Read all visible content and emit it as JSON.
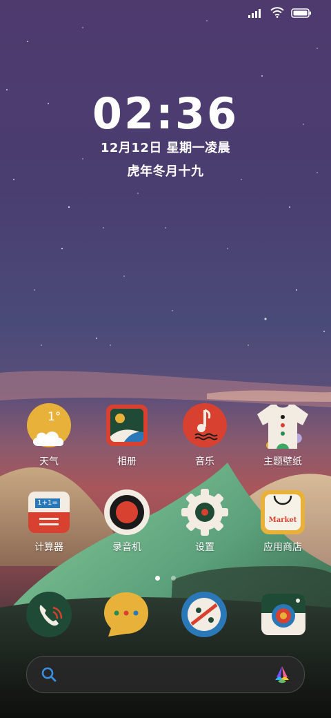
{
  "status": {
    "signal_icon": "signal-bars-icon",
    "wifi_icon": "wifi-icon",
    "battery_icon": "battery-full-icon"
  },
  "clock": {
    "time": "02:36",
    "date": "12月12日 星期一凌晨",
    "lunar": "虎年冬月十九"
  },
  "weather": {
    "temperature": "1°"
  },
  "apps": [
    {
      "label": "天气",
      "icon": "weather-icon"
    },
    {
      "label": "相册",
      "icon": "gallery-icon"
    },
    {
      "label": "音乐",
      "icon": "music-icon"
    },
    {
      "label": "主题壁纸",
      "icon": "themes-icon"
    },
    {
      "label": "计算器",
      "icon": "calculator-icon"
    },
    {
      "label": "录音机",
      "icon": "recorder-icon"
    },
    {
      "label": "设置",
      "icon": "settings-icon"
    },
    {
      "label": "应用商店",
      "icon": "app-store-icon"
    }
  ],
  "calculator_screen": "1+1=",
  "market_text": "Market",
  "page_indicator": {
    "pages": 2,
    "current": 1
  },
  "dock": [
    {
      "icon": "phone-icon"
    },
    {
      "icon": "messages-icon"
    },
    {
      "icon": "browser-icon"
    },
    {
      "icon": "camera-icon"
    }
  ],
  "search": {
    "search_icon": "search-icon",
    "assistant_icon": "assistant-icon"
  },
  "colors": {
    "accent_red": "#d8412f",
    "accent_green": "#1f4a36",
    "accent_yellow": "#e8b23a"
  }
}
